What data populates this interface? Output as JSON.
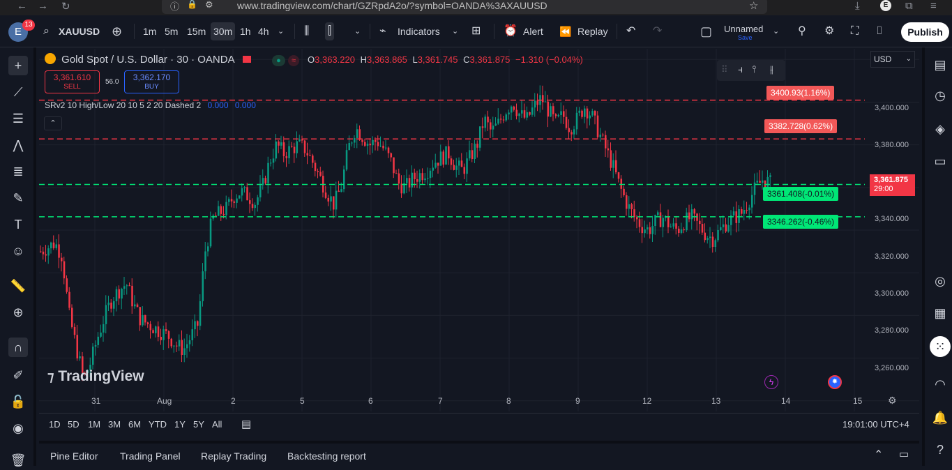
{
  "browser": {
    "url": "www.tradingview.com/chart/GZRpdA2o/?symbol=OANDA%3AXAUUSD",
    "profile_initial": "E"
  },
  "toolbar": {
    "avatar_letter": "E",
    "notification_count": "13",
    "symbol": "XAUUSD",
    "intervals": [
      "1m",
      "5m",
      "15m",
      "30m",
      "1h",
      "4h"
    ],
    "active_interval": "30m",
    "indicators": "Indicators",
    "alert": "Alert",
    "replay": "Replay",
    "layout_name": "Unnamed",
    "layout_save": "Save",
    "publish": "Publish"
  },
  "legend": {
    "title": "Gold Spot / U.S. Dollar · 30 · OANDA",
    "o_label": "O",
    "o_value": "3,363.220",
    "h_label": "H",
    "h_value": "3,363.865",
    "l_label": "L",
    "l_value": "3,361.745",
    "c_label": "C",
    "c_value": "3,361.875",
    "change": "−1.310 (−0.04%)",
    "sell_price": "3,361.610",
    "sell_label": "SELL",
    "spread": "56.0",
    "buy_price": "3,362.170",
    "buy_label": "BUY",
    "indicator": "SRv2 10 High/Low 20 10 5 2 20 Dashed 2",
    "indicator_v1": "0.000",
    "indicator_v2": "0.000"
  },
  "price_scale": {
    "currency": "USD",
    "ticks": [
      "3,400.000",
      "3,380.000",
      "3,340.000",
      "3,320.000",
      "3,300.000",
      "3,280.000",
      "3,260.000"
    ],
    "last_price": "3,361.875",
    "countdown": "29:00"
  },
  "levels": [
    {
      "label": "3400.93(1.16%)",
      "price": 3400.93,
      "color": "#f23645"
    },
    {
      "label": "3382.728(0.62%)",
      "price": 3382.728,
      "color": "#f23645"
    },
    {
      "label": "3361.408(-0.01%)",
      "price": 3361.408,
      "color": "#00e676"
    },
    {
      "label": "3346.262(-0.46%)",
      "price": 3346.262,
      "color": "#00e676"
    }
  ],
  "time_axis": [
    "31",
    "Aug",
    "2",
    "5",
    "6",
    "7",
    "8",
    "9",
    "12",
    "13",
    "14",
    "15"
  ],
  "watermark": "TradingView",
  "ranges": [
    "1D",
    "5D",
    "1M",
    "3M",
    "6M",
    "YTD",
    "1Y",
    "5Y",
    "All"
  ],
  "clock": "19:01:00 UTC+4",
  "panels": [
    "Pine Editor",
    "Trading Panel",
    "Replay Trading",
    "Backtesting report"
  ],
  "colors": {
    "up": "#089981",
    "down": "#f23645",
    "bg": "#131722",
    "accent": "#2962ff"
  },
  "chart_data": {
    "type": "candlestick",
    "symbol": "XAUUSD",
    "ylim": [
      3255,
      3425
    ],
    "closes": [
      3330,
      3332,
      3334,
      3328,
      3300,
      3285,
      3270,
      3278,
      3290,
      3300,
      3308,
      3312,
      3315,
      3305,
      3298,
      3296,
      3294,
      3292,
      3290,
      3286,
      3284,
      3290,
      3296,
      3330,
      3345,
      3348,
      3350,
      3356,
      3358,
      3356,
      3353,
      3360,
      3372,
      3380,
      3376,
      3378,
      3380,
      3378,
      3372,
      3365,
      3358,
      3352,
      3360,
      3378,
      3388,
      3384,
      3380,
      3382,
      3378,
      3372,
      3362,
      3360,
      3364,
      3366,
      3368,
      3372,
      3374,
      3376,
      3370,
      3368,
      3374,
      3380,
      3392,
      3386,
      3390,
      3396,
      3400,
      3394,
      3392,
      3398,
      3402,
      3396,
      3390,
      3394,
      3388,
      3392,
      3398,
      3394,
      3386,
      3378,
      3370,
      3360,
      3352,
      3346,
      3342,
      3340,
      3344,
      3346,
      3342,
      3340,
      3344,
      3346,
      3342,
      3338,
      3336,
      3340,
      3344,
      3346,
      3348,
      3354,
      3360,
      3364,
      3362
    ]
  }
}
